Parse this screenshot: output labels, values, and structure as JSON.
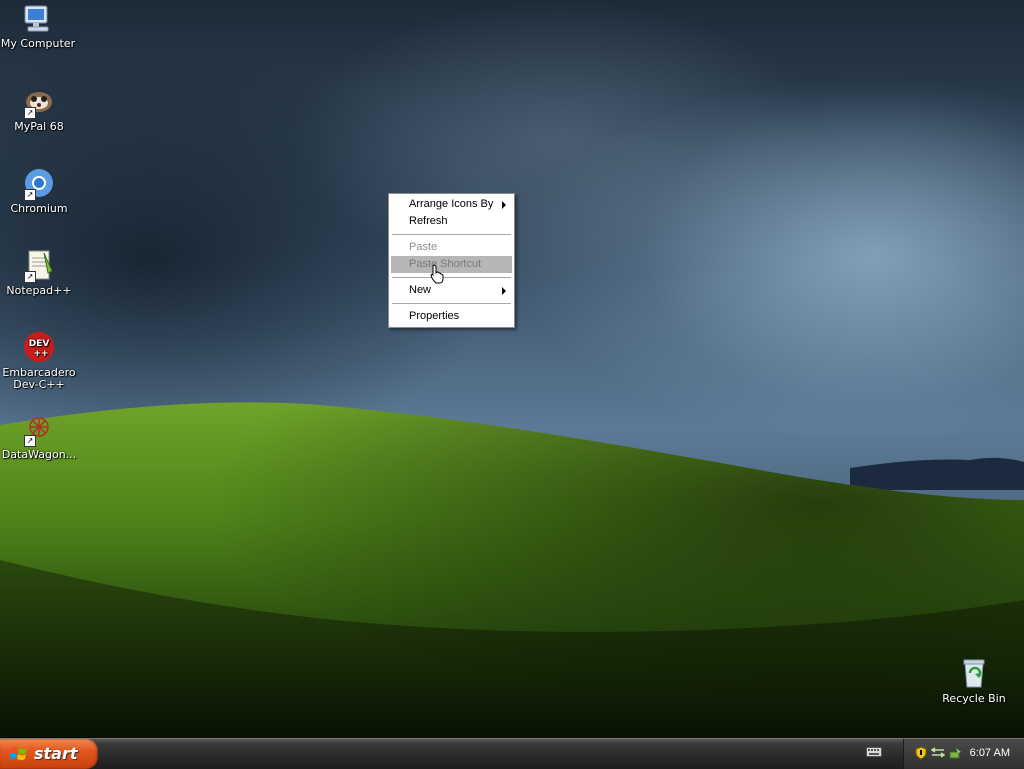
{
  "desktop": {
    "icons": [
      {
        "label": "My Computer",
        "icon": "my-computer-icon"
      },
      {
        "label": "MyPal 68",
        "icon": "mypal-icon"
      },
      {
        "label": "Chromium",
        "icon": "chromium-icon"
      },
      {
        "label": "Notepad++",
        "icon": "notepadpp-icon"
      },
      {
        "label": "Embarcadero Dev-C++",
        "line1": "Embarcadero",
        "line2": "Dev-C++",
        "icon": "devcpp-icon"
      },
      {
        "label": "DataWagon...",
        "icon": "datawagon-icon"
      }
    ],
    "recycle_bin": {
      "label": "Recycle Bin",
      "icon": "recycle-bin-icon"
    },
    "shortcut_arrow": "↗"
  },
  "context_menu": {
    "items": [
      {
        "label": "Arrange Icons By",
        "submenu": true,
        "enabled": true
      },
      {
        "label": "Refresh",
        "enabled": true
      },
      {
        "label": "Paste",
        "enabled": false
      },
      {
        "label": "Paste Shortcut",
        "enabled": false,
        "highlighted": true
      },
      {
        "label": "New",
        "submenu": true,
        "enabled": true
      },
      {
        "label": "Properties",
        "enabled": true
      }
    ]
  },
  "taskbar": {
    "start_label": "start",
    "clock": "6:07 AM",
    "tray_icons": [
      "keyboard-icon",
      "security-shield-icon",
      "network-icon",
      "safely-remove-hardware-icon"
    ]
  },
  "colors": {
    "start_button": "#e2561e",
    "menu_highlight": "#b6b6b6",
    "taskbar": "#2a2a2a"
  }
}
